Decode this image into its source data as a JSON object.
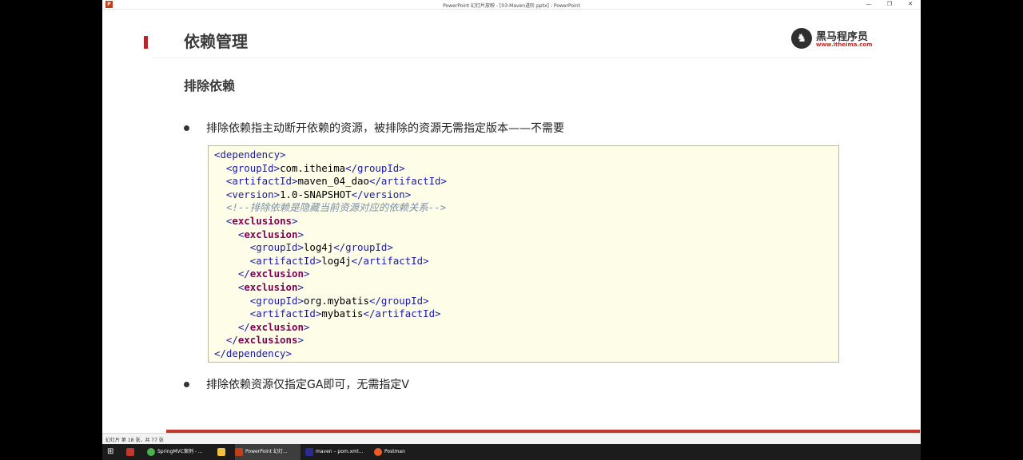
{
  "window": {
    "title": "PowerPoint 幻灯片放映 - [03-Maven进阶.pptx] - PowerPoint",
    "app_icon": "P"
  },
  "slide": {
    "title": "依赖管理",
    "subtitle": "排除依赖",
    "logo": {
      "cn": "黑马程序员",
      "url": "www.itheima.com"
    },
    "bullets": [
      "排除依赖指主动断开依赖的资源，被排除的资源无需指定版本——不需要",
      "排除依赖资源仅指定GA即可，无需指定V"
    ],
    "code": {
      "dep_open": "<dependency>",
      "group": "com.itheima",
      "artifact": "maven_04_dao",
      "version": "1.0-SNAPSHOT",
      "comment": "<!--排除依赖是隐藏当前资源对应的依赖关系-->",
      "ex1_group": "log4j",
      "ex1_artifact": "log4j",
      "ex2_group": "org.mybatis",
      "ex2_artifact": "mybatis",
      "dep_close": "</dependency>"
    }
  },
  "statusbar": {
    "text": "幻灯片 第 18 张，共 77 张"
  },
  "taskbar": {
    "items": [
      "SpringMVC案例 - ...",
      "PowerPoint 幻灯...",
      "maven – pom.xml...",
      "Postman"
    ]
  },
  "colors": {
    "accent": "#b2272b",
    "code_bg": "#fdfde8",
    "tag": "#1a1aa6",
    "keyword": "#7f0055"
  }
}
